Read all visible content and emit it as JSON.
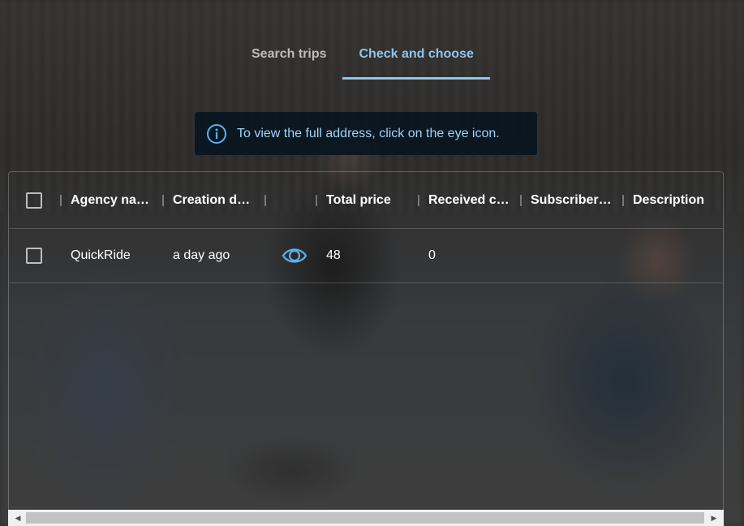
{
  "tabs": [
    {
      "label": "Search trips",
      "active": false
    },
    {
      "label": "Check and choose",
      "active": true
    }
  ],
  "info_banner": {
    "icon": "info-icon",
    "text": "To view the full address, click on the eye icon."
  },
  "table": {
    "columns": [
      {
        "key": "select",
        "label": ""
      },
      {
        "key": "agency_name",
        "label": "Agency na…"
      },
      {
        "key": "creation_date",
        "label": "Creation d…"
      },
      {
        "key": "address",
        "label": ""
      },
      {
        "key": "total_price",
        "label": "Total price"
      },
      {
        "key": "received",
        "label": "Received c…"
      },
      {
        "key": "subscribers",
        "label": "Subscriber…"
      },
      {
        "key": "description",
        "label": "Description"
      }
    ],
    "rows": [
      {
        "agency_name": "QuickRide",
        "creation_date": "a day ago",
        "address_icon": "eye-icon",
        "total_price": "48",
        "received": "0",
        "subscribers": "",
        "description": ""
      }
    ]
  },
  "colors": {
    "accent": "#8ec5ee",
    "banner_bg": "#081620",
    "banner_text": "#9fd3f7",
    "inactive_tab": "#bdbdbd"
  }
}
